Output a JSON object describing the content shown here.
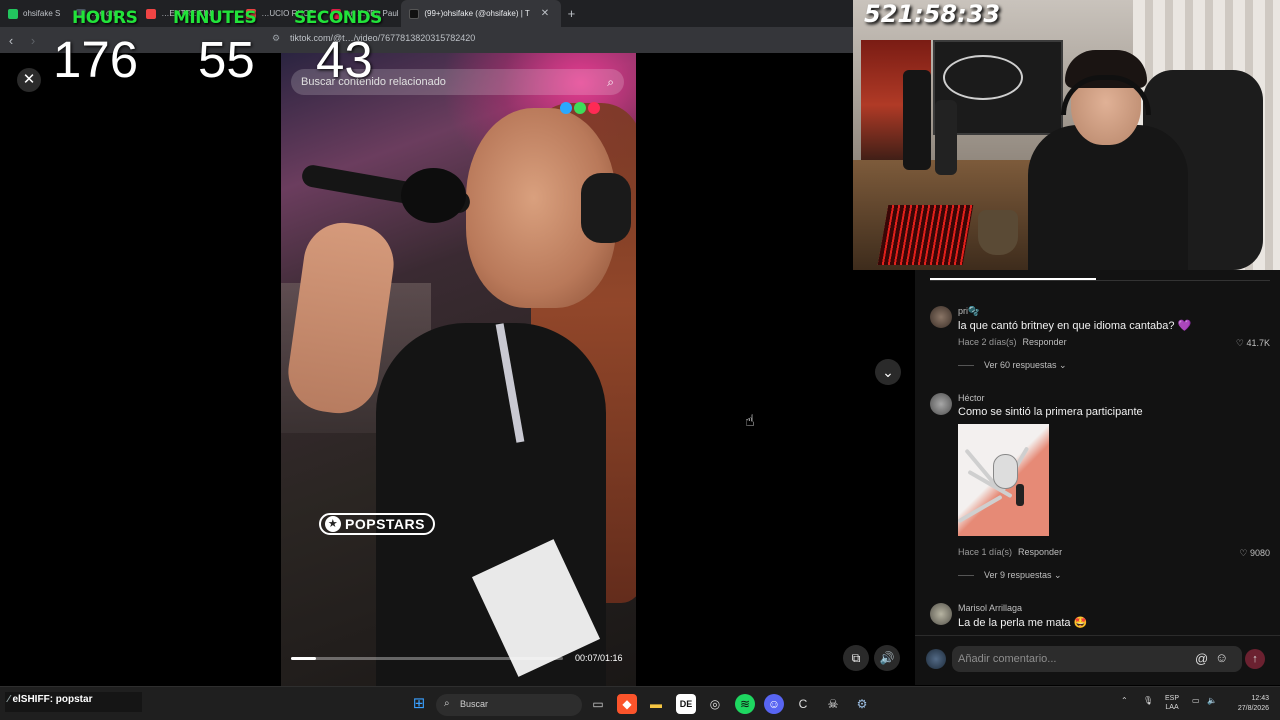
{
  "browser": {
    "tabs": [
      {
        "label": "ohsifake S",
        "active": false,
        "color": "#22c55e"
      },
      {
        "label": "…e on",
        "active": false,
        "color": "#6b7280"
      },
      {
        "label": "…ENTRE TINI",
        "active": false,
        "color": "#ef4444"
      },
      {
        "label": "…UCIO RHCP",
        "active": false,
        "color": "#ef4444"
      },
      {
        "label": "en X: \"De Paul",
        "active": false,
        "color": "#111111"
      },
      {
        "label": "(99+)ohsifake (@ohsifake) | T",
        "active": true,
        "color": "#111111"
      }
    ],
    "url": "tiktok.com/@t…/video/7677813820315782420"
  },
  "timer": {
    "hours_label": "HOURS",
    "minutes_label": "MINUTES",
    "seconds_label": "SECONDS",
    "hours": "176",
    "minutes": "55",
    "seconds": "43",
    "total_clock": "521:58:33"
  },
  "video": {
    "search_placeholder": "Buscar contenido relacionado",
    "brand": "POPSTARS",
    "time": "00:07/01:16",
    "progress": 0.092,
    "dot_colors": [
      "#2aa8ff",
      "#3ddc5a",
      "#ff2a55"
    ]
  },
  "comments": [
    {
      "user": "pri🫧",
      "text": "la que cantó britney en que idioma cantaba? 💜",
      "date": "Hace 2 días(s)",
      "reply": "Responder",
      "likes": "41.7K",
      "replies": "Ver 60 respuestas ⌄",
      "avatar_color": "#6a5a4e"
    },
    {
      "user": "Héctor",
      "text": "Como se sintió la primera participante",
      "date": "Hace 1 día(s)",
      "reply": "Responder",
      "likes": "9080",
      "replies": "Ver 9 respuestas ⌄",
      "avatar_color": "#8a8a8a"
    },
    {
      "user": "Marisol Arrillaga",
      "text": "La de la perla me mata 🤩",
      "avatar_color": "#9a9a8a"
    }
  ],
  "input": {
    "placeholder": "Añadir comentario..."
  },
  "taskbar": {
    "chat_user": "elSHIFF",
    "chat_message": ": popstar",
    "search_label": "Buscar",
    "lang": "ESP",
    "lang2": "LAA",
    "time": "12:43",
    "date": "27/8/2026"
  }
}
